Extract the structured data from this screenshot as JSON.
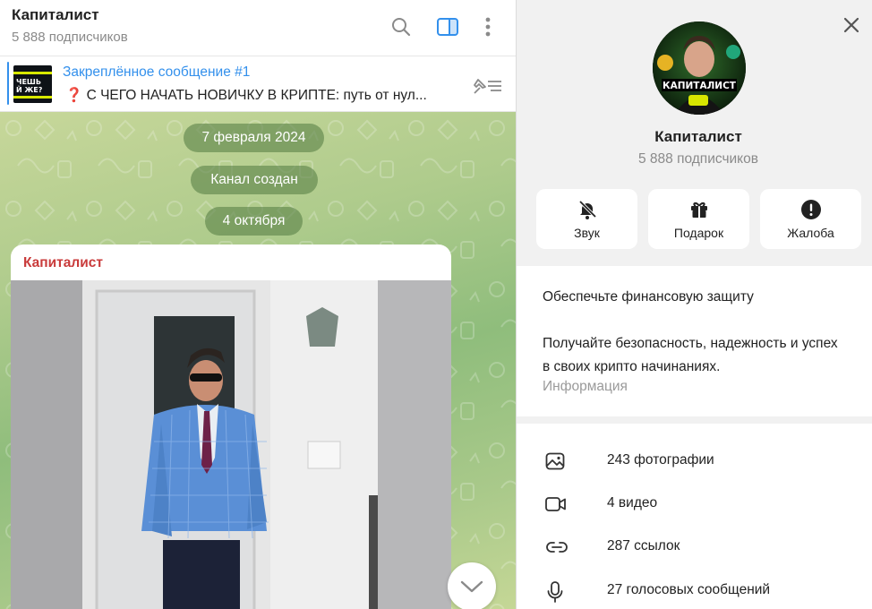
{
  "channel": {
    "name": "Капиталист",
    "subscribers": "5 888 подписчиков"
  },
  "pinned": {
    "title": "Закреплённое сообщение #1",
    "text": "❓ С ЧЕГО НАЧАТЬ НОВИЧКУ В КРИПТЕ: путь от нул...",
    "thumb_text": "ЧЕШЬ\nЙ ЖЕ?"
  },
  "chat": {
    "date1": "7 февраля 2024",
    "service": "Канал создан",
    "date2": "4 октября",
    "message_author": "Капиталист"
  },
  "profile": {
    "name": "Капиталист",
    "subscribers": "5 888 подписчиков",
    "avatar_text": "КАПИТАЛИСТ",
    "actions": [
      {
        "label": "Звук",
        "icon": "bell-off-icon"
      },
      {
        "label": "Подарок",
        "icon": "gift-icon"
      },
      {
        "label": "Жалоба",
        "icon": "exclamation-icon"
      }
    ],
    "info": {
      "line1": "Обеспечьте финансовую защиту",
      "paragraph": "Получайте безопасность, надежность и успех в своих крипто начинаниях.",
      "label": "Информация"
    },
    "media": [
      {
        "label": "243 фотографии",
        "icon": "photo-icon"
      },
      {
        "label": "4 видео",
        "icon": "video-icon"
      },
      {
        "label": "287 ссылок",
        "icon": "link-icon"
      },
      {
        "label": "27 голосовых сообщений",
        "icon": "microphone-icon"
      }
    ]
  },
  "colors": {
    "accent": "#3390ec",
    "author": "#c93b3b",
    "service_pill": "#5c8248"
  }
}
